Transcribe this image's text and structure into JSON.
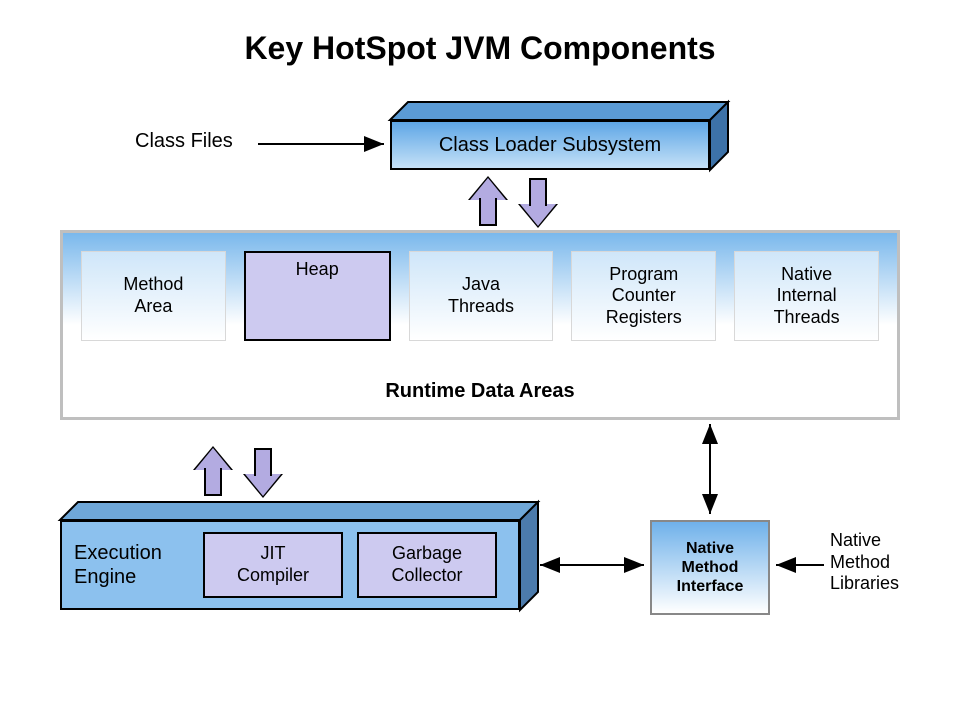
{
  "title": "Key HotSpot JVM Components",
  "class_files_label": "Class Files",
  "class_loader": {
    "label": "Class Loader Subsystem"
  },
  "runtime_data_areas": {
    "label": "Runtime Data Areas",
    "cells": {
      "method_area": "Method\nArea",
      "heap": "Heap",
      "java_threads": "Java\nThreads",
      "pc_registers": "Program\nCounter\nRegisters",
      "native_threads": "Native\nInternal\nThreads"
    }
  },
  "execution_engine": {
    "label": "Execution\nEngine",
    "jit": "JIT\nCompiler",
    "gc": "Garbage\nCollector"
  },
  "native_method_interface": "Native\nMethod\nInterface",
  "native_method_libraries": "Native\nMethod\nLibraries",
  "colors": {
    "block_blue": "#8cc1ee",
    "block_purple": "#cdcaf0",
    "arrow_purple": "#b3abe1"
  }
}
